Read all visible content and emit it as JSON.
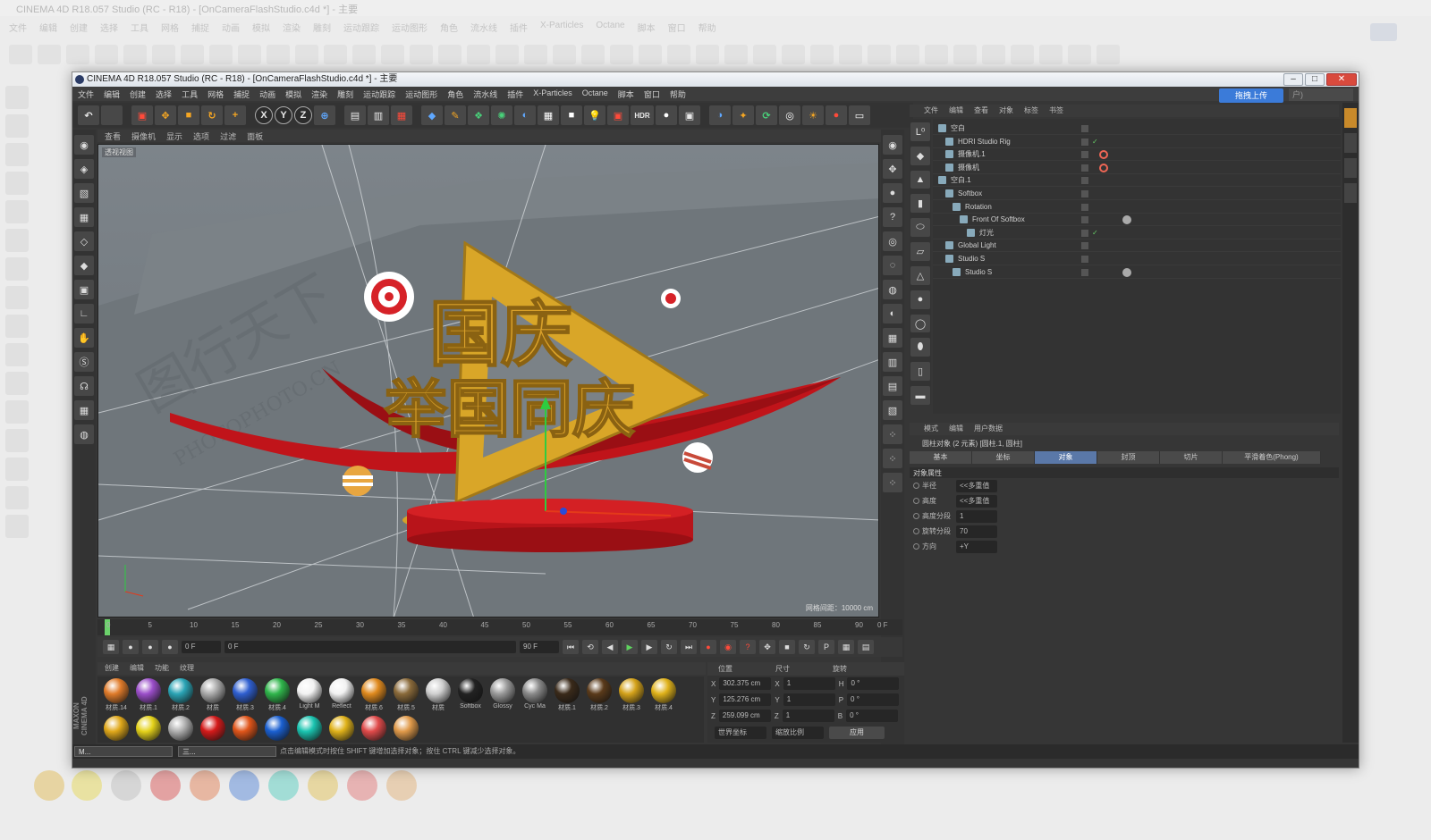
{
  "background": {
    "title": "CINEMA 4D R18.057 Studio (RC - R18) - [OnCameraFlashStudio.c4d *] - 主要",
    "menu": [
      "文件",
      "编辑",
      "创建",
      "选择",
      "工具",
      "网格",
      "捕捉",
      "动画",
      "模拟",
      "渲染",
      "雕刻",
      "运动跟踪",
      "运动图形",
      "角色",
      "流水线",
      "插件",
      "X-Particles",
      "Octane",
      "脚本",
      "窗口",
      "帮助"
    ]
  },
  "window": {
    "title": "CINEMA 4D R18.057 Studio (RC - R18) - [OnCameraFlashStudio.c4d *] - 主要",
    "upload_label": "拖拽上传",
    "layout_label": "户)"
  },
  "menu": [
    "文件",
    "编辑",
    "创建",
    "选择",
    "工具",
    "网格",
    "捕捉",
    "动画",
    "模拟",
    "渲染",
    "雕刻",
    "运动跟踪",
    "运动图形",
    "角色",
    "流水线",
    "插件",
    "X-Particles",
    "Octane",
    "脚本",
    "窗口",
    "帮助"
  ],
  "toolbar": {
    "axis_x": "X",
    "axis_y": "Y",
    "axis_z": "Z",
    "hdr": "HDR"
  },
  "viewport": {
    "menu": [
      "查看",
      "摄像机",
      "显示",
      "选项",
      "过滤",
      "面板"
    ],
    "label": "透视视图",
    "grid_info": "网格间距：10000 cm",
    "title_line1": "国庆",
    "title_line2": "举国同庆",
    "watermark": "PHOTOPHOTO.CN"
  },
  "timeline": {
    "ticks": [
      "0",
      "5",
      "10",
      "15",
      "20",
      "25",
      "30",
      "35",
      "40",
      "45",
      "50",
      "55",
      "60",
      "65",
      "70",
      "75",
      "80",
      "85",
      "90"
    ],
    "end_frame": "0 F"
  },
  "transport": {
    "current": "0 F",
    "range_start": "0 F",
    "range_end": "90 F",
    "max": "90 F"
  },
  "materials": {
    "menu": [
      "创建",
      "编辑",
      "功能",
      "纹理"
    ],
    "row1": [
      {
        "label": "材质.14",
        "color": "#e07b2a"
      },
      {
        "label": "材质.1",
        "color": "#9b4ec9"
      },
      {
        "label": "材质.2",
        "color": "#2aa4b5"
      },
      {
        "label": "材质",
        "color": "#aaaaaa"
      },
      {
        "label": "材质.3",
        "color": "#2f5fd0"
      },
      {
        "label": "材质.4",
        "color": "#2fb54b"
      },
      {
        "label": "Light M",
        "color": "#f2f2f2"
      },
      {
        "label": "Reflect",
        "color": "#f2f2f2"
      },
      {
        "label": "材质.6",
        "color": "#e08a1e"
      },
      {
        "label": "材质.5",
        "color": "#8a6a3a"
      },
      {
        "label": "材质",
        "color": "#cfcfcf"
      },
      {
        "label": "Softbox",
        "color": "#222222"
      },
      {
        "label": "Glossy",
        "color": "#9a9a9a"
      },
      {
        "label": "Cyc Ma",
        "color": "#8a8a8a"
      },
      {
        "label": "材质.1",
        "color": "#3a2a1a"
      },
      {
        "label": "材质.2",
        "color": "#5a3a1a"
      },
      {
        "label": "材质.3",
        "color": "#d4a21a"
      },
      {
        "label": "材质.4",
        "color": "#e0b21a"
      }
    ],
    "row2": [
      {
        "color": "#e0a81a"
      },
      {
        "color": "#e4d21a"
      },
      {
        "color": "#b0b0b0"
      },
      {
        "color": "#d41a1a"
      },
      {
        "color": "#e0551a"
      },
      {
        "color": "#1a5fd0"
      },
      {
        "color": "#1ac4b0"
      },
      {
        "color": "#e0b21a"
      },
      {
        "color": "#e04a4a"
      },
      {
        "color": "#e09a4a"
      }
    ]
  },
  "coords": {
    "headers": [
      "位置",
      "尺寸",
      "旋转"
    ],
    "rows": [
      {
        "axis": "X",
        "pos": "302.375 cm",
        "size_axis": "X",
        "size": "1",
        "rot_axis": "H",
        "rot": "0 °"
      },
      {
        "axis": "Y",
        "pos": "125.276 cm",
        "size_axis": "Y",
        "size": "1",
        "rot_axis": "P",
        "rot": "0 °"
      },
      {
        "axis": "Z",
        "pos": "259.099 cm",
        "size_axis": "Z",
        "size": "1",
        "rot_axis": "B",
        "rot": "0 °"
      }
    ],
    "mode": "世界坐标",
    "scale_mode": "缩放比例",
    "apply": "应用"
  },
  "status": {
    "text": "点击编辑模式时按住 SHIFT 键增加选择对象；按住 CTRL 键减少选择对象。",
    "task1": "M...",
    "task2": "三..."
  },
  "object_manager": {
    "menu": [
      "文件",
      "编辑",
      "查看",
      "对象",
      "标签",
      "书签"
    ],
    "objects": [
      {
        "label": "空白",
        "indent": 0
      },
      {
        "label": "HDRI Studio Rig",
        "indent": 1
      },
      {
        "label": "摄像机.1",
        "indent": 1
      },
      {
        "label": "摄像机",
        "indent": 1
      },
      {
        "label": "空白.1",
        "indent": 0
      },
      {
        "label": "Softbox",
        "indent": 1
      },
      {
        "label": "Rotation",
        "indent": 2
      },
      {
        "label": "Front Of Softbox",
        "indent": 3
      },
      {
        "label": "灯光",
        "indent": 4
      },
      {
        "label": "Global Light",
        "indent": 1
      },
      {
        "label": "Studio S",
        "indent": 1
      },
      {
        "label": "Studio S",
        "indent": 2
      }
    ]
  },
  "attributes": {
    "menu": [
      "模式",
      "编辑",
      "用户数据"
    ],
    "title": "圆柱对象 (2 元素) [圆柱.1, 圆柱]",
    "tabs": [
      "基本",
      "坐标",
      "对象",
      "封顶",
      "切片",
      "平滑着色(Phong)"
    ],
    "active_tab": "对象",
    "section": "对象属性",
    "fields": [
      {
        "label": "半径",
        "value": "<<多重值>>"
      },
      {
        "label": "高度",
        "value": "<<多重值>>"
      },
      {
        "label": "高度分段",
        "value": "1"
      },
      {
        "label": "旋转分段",
        "value": "70"
      },
      {
        "label": "方向",
        "value": "+Y"
      }
    ]
  },
  "brand": "MAXON CINEMA 4D"
}
